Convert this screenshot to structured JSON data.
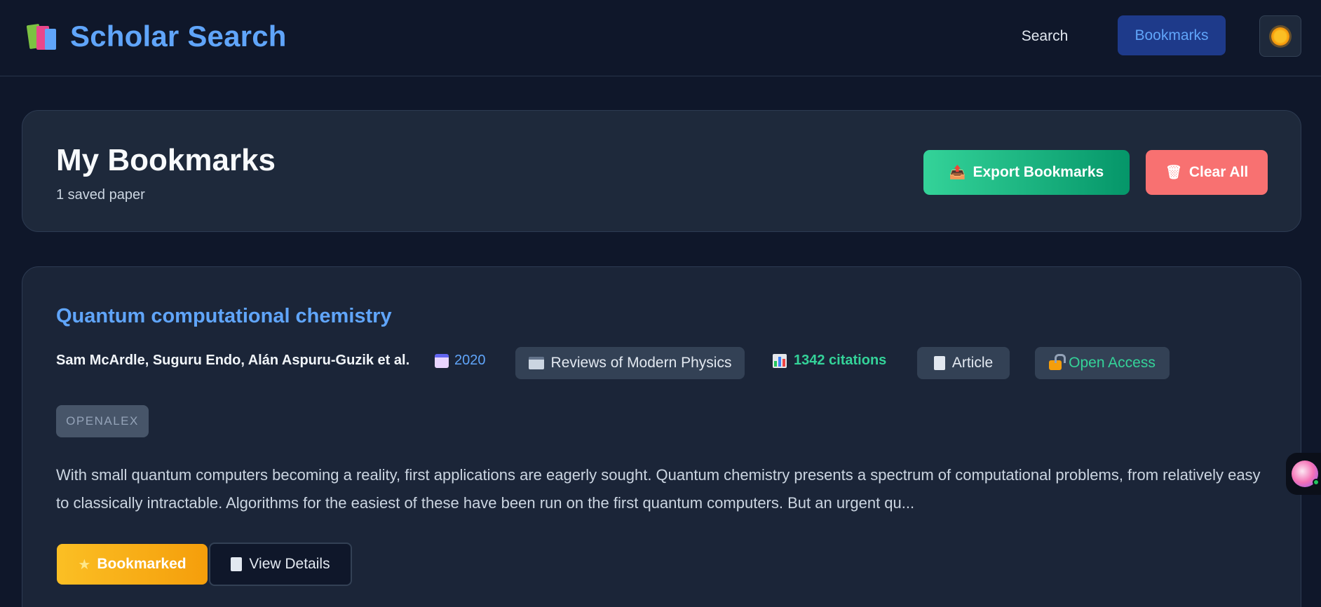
{
  "app": {
    "title": "Scholar Search",
    "nav": {
      "search_label": "Search",
      "bookmarks_label": "Bookmarks"
    }
  },
  "header": {
    "title": "My Bookmarks",
    "subtitle": "1 saved paper",
    "export_label": "Export Bookmarks",
    "clear_label": "Clear All"
  },
  "papers": [
    {
      "title": "Quantum computational chemistry",
      "authors": "Sam McArdle, Suguru Endo, Alán Aspuru-Guzik et al.",
      "year": "2020",
      "venue": "Reviews of Modern Physics",
      "citations": "1342 citations",
      "type": "Article",
      "access": "Open Access",
      "source": "OPENALEX",
      "abstract": "With small quantum computers becoming a reality, first applications are eagerly sought. Quantum chemistry presents a spectrum of computational problems, from relatively easy to classically intractable. Algorithms for the easiest of these have been run on the first quantum computers. But an urgent qu...",
      "bookmark_label": "Bookmarked",
      "details_label": "View Details"
    }
  ],
  "colors": {
    "background": "#0f172a",
    "card": "#1e293b",
    "accent_blue": "#60a5fa",
    "accent_green": "#34d399",
    "danger": "#f87171",
    "bookmark_gold": "#fbbf24"
  },
  "icons": {
    "brand": "books-icon",
    "theme": "sun-icon",
    "export": "outbox-icon",
    "clear": "wastebasket-icon",
    "year": "calendar-icon",
    "venue": "newspaper-icon",
    "citations": "bar-chart-icon",
    "type": "document-icon",
    "access": "unlocked-icon",
    "bookmark": "star-icon",
    "details": "document-icon",
    "assistant": "assistant-avatar-icon"
  }
}
